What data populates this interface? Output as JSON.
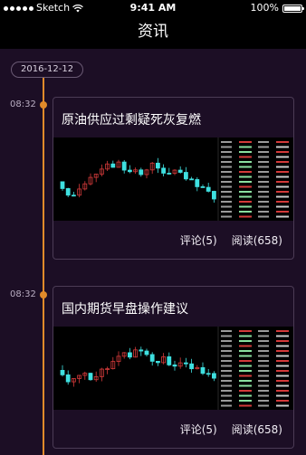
{
  "status_bar": {
    "carrier": "Sketch",
    "time": "9:41 AM",
    "battery": "100%"
  },
  "nav": {
    "title": "资讯"
  },
  "timeline": {
    "date": "2016-12-12",
    "items": [
      {
        "time": "08:32",
        "title": "原油供应过剩疑死灰复燃",
        "comments": "评论(5)",
        "reads": "阅读(658)"
      },
      {
        "time": "08:32",
        "title": "国内期货早盘操作建议",
        "comments": "评论(5)",
        "reads": "阅读(658)"
      }
    ]
  },
  "colors": {
    "accent": "#e08a2a",
    "background": "#1c0e25",
    "up": "#d33a3a",
    "down": "#3fe0e0"
  }
}
